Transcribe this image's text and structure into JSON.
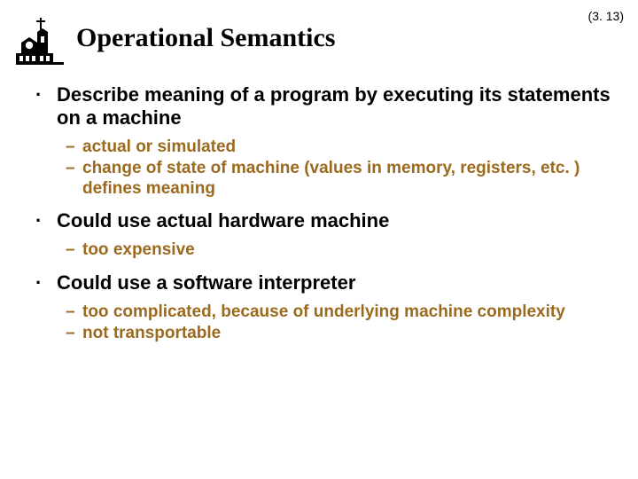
{
  "slideNumber": "(3. 13)",
  "title": "Operational Semantics",
  "bullets": {
    "b1": "Describe meaning of a program by executing its statements on a machine",
    "b1s1": "actual or simulated",
    "b1s2": "change of state of machine (values in memory, registers, etc. ) defines meaning",
    "b2": "Could use actual hardware machine",
    "b2s1": "too expensive",
    "b3": "Could use a software interpreter",
    "b3s1": "too complicated, because of underlying machine complexity",
    "b3s2": "not transportable"
  },
  "markers": {
    "square": "·",
    "dash": "–"
  }
}
